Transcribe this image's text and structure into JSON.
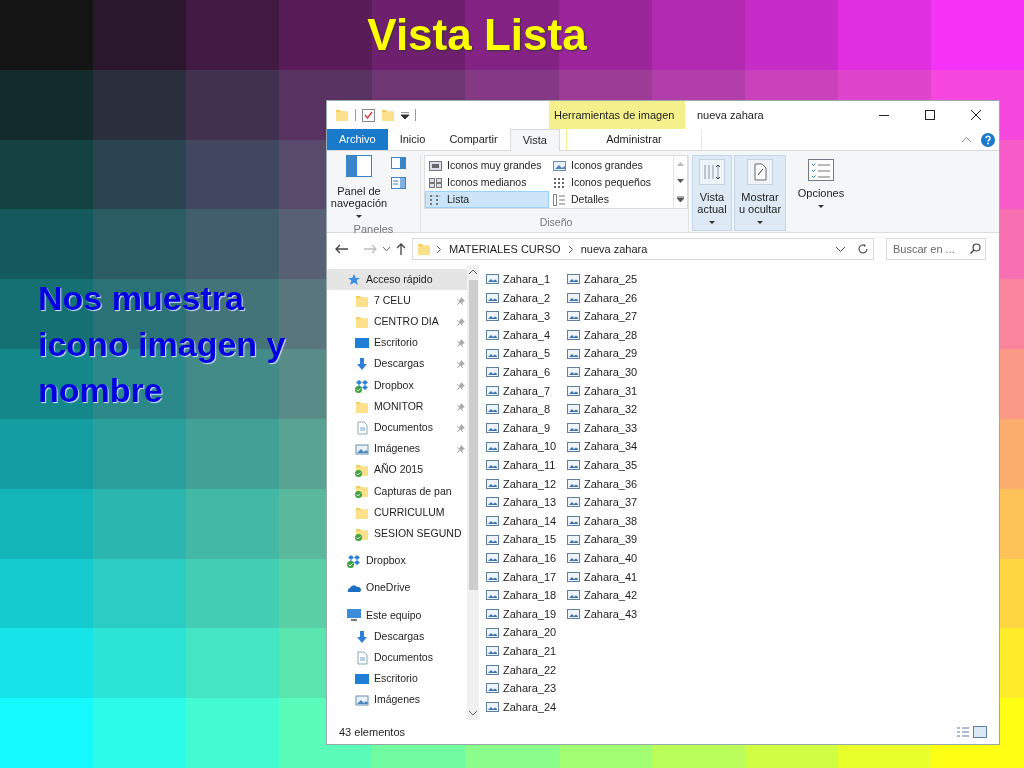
{
  "slide": {
    "title": "Vista Lista",
    "caption": "Nos muestra icono imagen y nombre"
  },
  "window": {
    "title": "nueva zahara",
    "context_label": "Herramientas de imagen"
  },
  "ribbon_tabs": [
    {
      "label": "Archivo",
      "kind": "file",
      "selected": false
    },
    {
      "label": "Inicio",
      "kind": "plain",
      "selected": false
    },
    {
      "label": "Compartir",
      "kind": "plain",
      "selected": false
    },
    {
      "label": "Vista",
      "kind": "plain",
      "selected": true
    },
    {
      "label": "Administrar",
      "kind": "context",
      "selected": false
    }
  ],
  "ribbon": {
    "panes_button": "Panel de navegación",
    "panes_group": "Paneles",
    "layouts": [
      {
        "label": "Iconos muy grandes",
        "selected": false
      },
      {
        "label": "Iconos grandes",
        "selected": false
      },
      {
        "label": "Iconos medianos",
        "selected": false
      },
      {
        "label": "Iconos pequeños",
        "selected": false
      },
      {
        "label": "Lista",
        "selected": true
      },
      {
        "label": "Detalles",
        "selected": false
      }
    ],
    "layout_group": "Diseño",
    "buttons": [
      {
        "label": "Vista actual",
        "highlighted": true
      },
      {
        "label": "Mostrar u ocultar",
        "highlighted": true
      },
      {
        "label": "Opciones",
        "highlighted": false
      }
    ]
  },
  "address": {
    "path": [
      "MATERIALES CURSO",
      "nueva zahara"
    ],
    "search_placeholder": "Buscar en ..."
  },
  "nav": [
    {
      "label": "Acceso rápido",
      "kind": "star",
      "selected": true,
      "children": [
        {
          "label": "7 CELU",
          "kind": "folder",
          "pinned": true,
          "synced": false
        },
        {
          "label": "CENTRO DIA",
          "kind": "folder",
          "pinned": true,
          "synced": false
        },
        {
          "label": "Escritorio",
          "kind": "desktop",
          "pinned": true,
          "synced": false
        },
        {
          "label": "Descargas",
          "kind": "download",
          "pinned": true,
          "synced": false
        },
        {
          "label": "Dropbox",
          "kind": "dropbox",
          "pinned": true,
          "synced": true
        },
        {
          "label": "MONITOR",
          "kind": "folder",
          "pinned": true,
          "synced": false
        },
        {
          "label": "Documentos",
          "kind": "document",
          "pinned": true,
          "synced": false
        },
        {
          "label": "Imágenes",
          "kind": "image",
          "pinned": true,
          "synced": false
        },
        {
          "label": "AÑO 2015",
          "kind": "folder",
          "pinned": false,
          "synced": true
        },
        {
          "label": "Capturas de pan",
          "kind": "folder",
          "pinned": false,
          "synced": true
        },
        {
          "label": "CURRICULUM",
          "kind": "folder",
          "pinned": false,
          "synced": false
        },
        {
          "label": "SESION SEGUND",
          "kind": "folder",
          "pinned": false,
          "synced": true
        }
      ]
    },
    {
      "label": "Dropbox",
      "kind": "dropbox",
      "selected": false,
      "synced": true
    },
    {
      "label": "OneDrive",
      "kind": "cloud",
      "selected": false
    },
    {
      "label": "Este equipo",
      "kind": "pc",
      "selected": false,
      "children": [
        {
          "label": "Descargas",
          "kind": "download"
        },
        {
          "label": "Documentos",
          "kind": "document"
        },
        {
          "label": "Escritorio",
          "kind": "desktop"
        },
        {
          "label": "Imágenes",
          "kind": "image"
        }
      ]
    }
  ],
  "files": [
    "Zahara_1",
    "Zahara_2",
    "Zahara_3",
    "Zahara_4",
    "Zahara_5",
    "Zahara_6",
    "Zahara_7",
    "Zahara_8",
    "Zahara_9",
    "Zahara_10",
    "Zahara_11",
    "Zahara_12",
    "Zahara_13",
    "Zahara_14",
    "Zahara_15",
    "Zahara_16",
    "Zahara_17",
    "Zahara_18",
    "Zahara_19",
    "Zahara_20",
    "Zahara_21",
    "Zahara_22",
    "Zahara_23",
    "Zahara_24",
    "Zahara_25",
    "Zahara_26",
    "Zahara_27",
    "Zahara_28",
    "Zahara_29",
    "Zahara_30",
    "Zahara_31",
    "Zahara_32",
    "Zahara_33",
    "Zahara_34",
    "Zahara_35",
    "Zahara_36",
    "Zahara_37",
    "Zahara_38",
    "Zahara_39",
    "Zahara_40",
    "Zahara_41",
    "Zahara_42",
    "Zahara_43"
  ],
  "status": {
    "count": "43 elementos"
  }
}
